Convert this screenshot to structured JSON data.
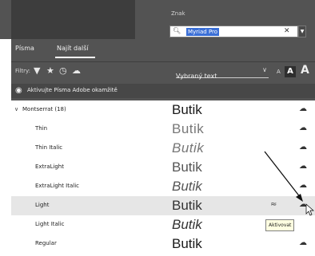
{
  "top": {
    "label": "Znak",
    "search_value": "Myriad Pro",
    "clear_icon": "close-icon",
    "dropdown_icon": "chevron-down-icon"
  },
  "tabs": [
    {
      "label": "Písma"
    },
    {
      "label": "Najít další"
    }
  ],
  "filters": {
    "label": "Filtry:",
    "icons": [
      "filter-icon",
      "star-icon",
      "recent-icon",
      "cloud-icon"
    ],
    "preview_select": "Vybraný text",
    "size_small": "A",
    "size_medium": "A",
    "size_large": "A"
  },
  "activate": {
    "icon": "adobe-fonts-icon",
    "text": "Aktivujte Písma Adobe okamžitě"
  },
  "family": {
    "label": "Montserrat (18)"
  },
  "fonts": [
    {
      "name": "Thin",
      "sample": "Butik"
    },
    {
      "name": "Thin Italic",
      "sample": "Butik"
    },
    {
      "name": "ExtraLight",
      "sample": "Butik"
    },
    {
      "name": "ExtraLight Italic",
      "sample": "Butik"
    },
    {
      "name": "Light",
      "sample": "Butik"
    },
    {
      "name": "Light Italic",
      "sample": "Butik"
    },
    {
      "name": "Regular",
      "sample": "Butik"
    }
  ],
  "family_sample": "Butik",
  "tooltip": "Aktivovat",
  "colors": {
    "panel": "#535353",
    "selection": "#3b6fd6",
    "row_highlight": "#e6e6e6"
  }
}
